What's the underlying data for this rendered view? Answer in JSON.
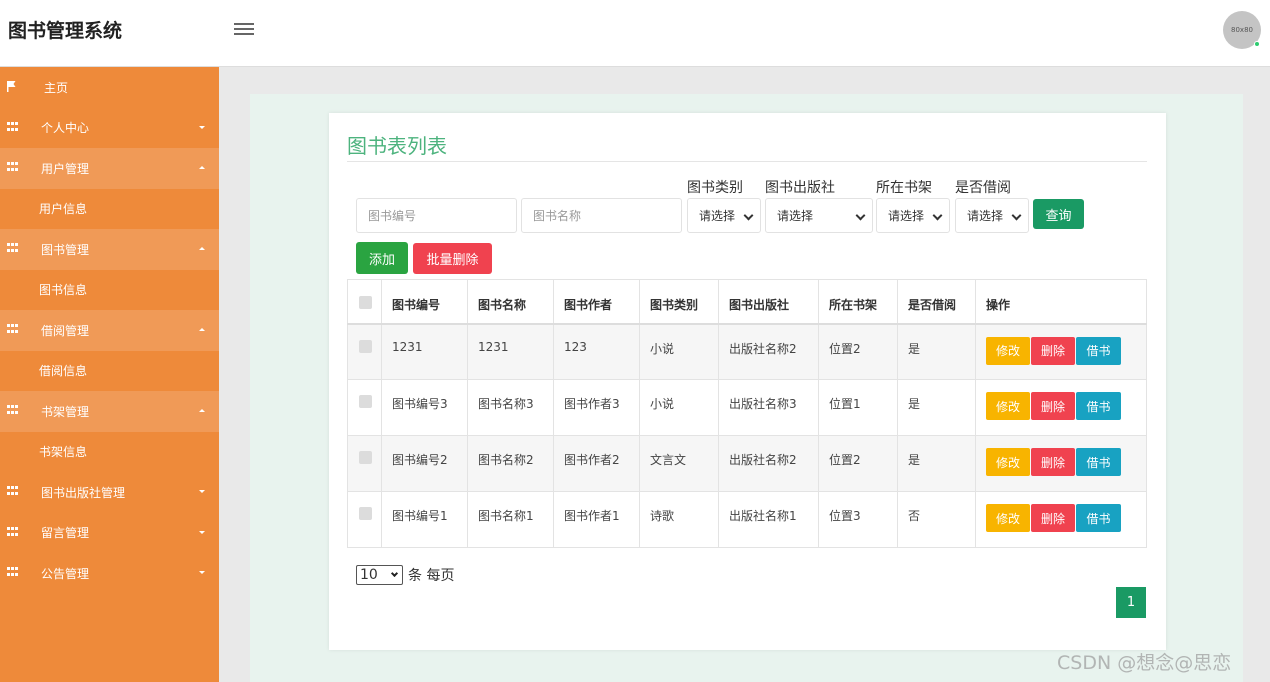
{
  "app": {
    "title": "图书管理系统",
    "avatar_text": "80x80"
  },
  "sidebar": {
    "items": [
      {
        "label": "主页"
      },
      {
        "label": "个人中心"
      },
      {
        "label": "用户管理"
      },
      {
        "label": "用户信息"
      },
      {
        "label": "图书管理"
      },
      {
        "label": "图书信息"
      },
      {
        "label": "借阅管理"
      },
      {
        "label": "借阅信息"
      },
      {
        "label": "书架管理"
      },
      {
        "label": "书架信息"
      },
      {
        "label": "图书出版社管理"
      },
      {
        "label": "留言管理"
      },
      {
        "label": "公告管理"
      }
    ]
  },
  "page": {
    "title": "图书表列表"
  },
  "filters": {
    "book_no_placeholder": "图书编号",
    "book_name_placeholder": "图书名称",
    "category_label": "图书类别",
    "category_value": "请选择",
    "publisher_label": "图书出版社",
    "publisher_value": "请选择",
    "shelf_label": "所在书架",
    "shelf_value": "请选择",
    "borrowed_label": "是否借阅",
    "borrowed_value": "请选择",
    "search_button": "查询"
  },
  "actions": {
    "add": "添加",
    "batch_delete": "批量删除"
  },
  "table": {
    "headers": [
      "图书编号",
      "图书名称",
      "图书作者",
      "图书类别",
      "图书出版社",
      "所在书架",
      "是否借阅",
      "操作"
    ],
    "rows": [
      [
        "1231",
        "1231",
        "123",
        "小说",
        "出版社名称2",
        "位置2",
        "是"
      ],
      [
        "图书编号3",
        "图书名称3",
        "图书作者3",
        "小说",
        "出版社名称3",
        "位置1",
        "是"
      ],
      [
        "图书编号2",
        "图书名称2",
        "图书作者2",
        "文言文",
        "出版社名称2",
        "位置2",
        "是"
      ],
      [
        "图书编号1",
        "图书名称1",
        "图书作者1",
        "诗歌",
        "出版社名称1",
        "位置3",
        "否"
      ]
    ],
    "op_labels": {
      "edit": "修改",
      "delete": "删除",
      "borrow": "借书"
    }
  },
  "pagination": {
    "page_size": "10",
    "per_page_text": "条 每页",
    "current_page": "1"
  },
  "watermark": "CSDN @想念@思恋",
  "colors": {
    "sidebar": "#ee8a3a",
    "accent_green": "#1a9a64",
    "title_green": "#4db37e",
    "danger": "#f0424f",
    "warning": "#f8b400",
    "info": "#18a2c2"
  }
}
